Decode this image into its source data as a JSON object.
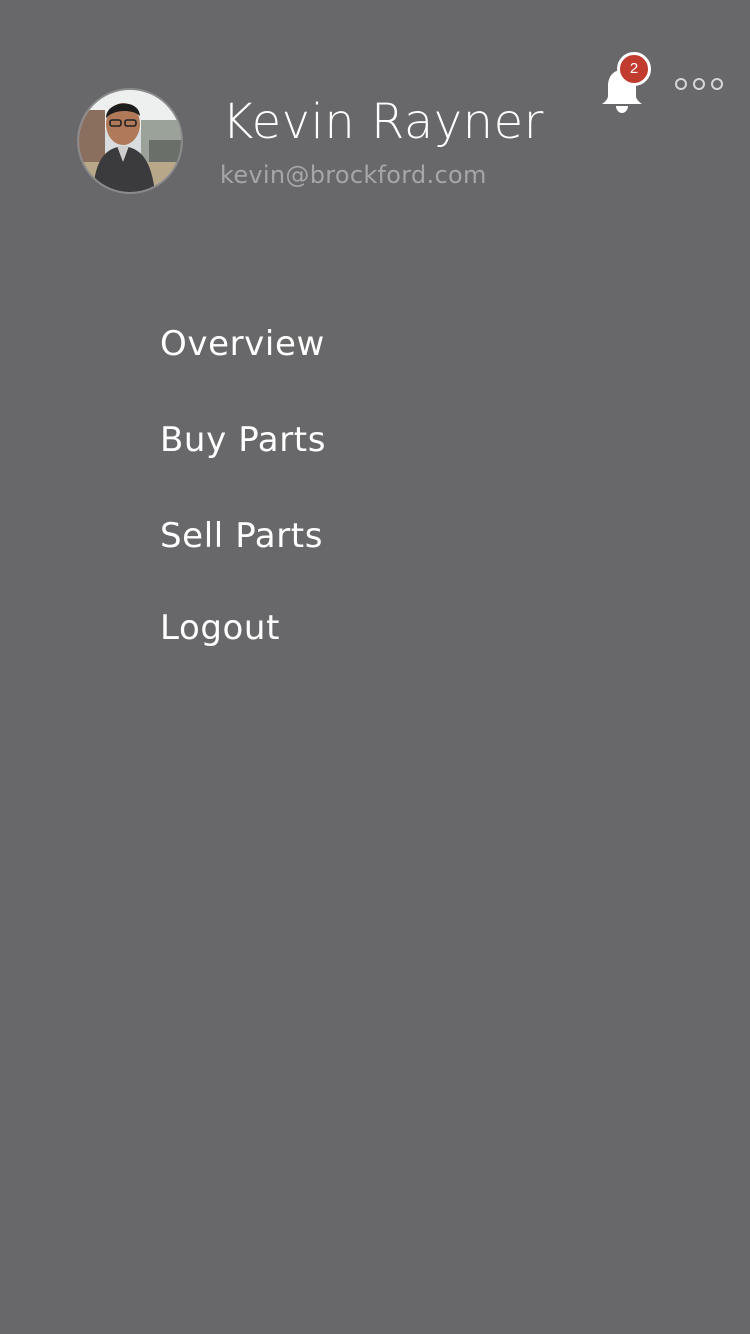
{
  "header": {
    "notifications": {
      "icon": "bell-icon",
      "count": "2",
      "badge_color": "#c23b2f"
    },
    "more_icon": "more-horizontal-icon"
  },
  "profile": {
    "name": "Kevin Rayner",
    "email": "kevin@brockford.com",
    "avatar": "user-avatar-photo"
  },
  "menu": {
    "items": [
      {
        "label": "Overview"
      },
      {
        "label": "Buy Parts"
      },
      {
        "label": "Sell Parts"
      },
      {
        "label": "Logout"
      }
    ]
  },
  "colors": {
    "background": "#68686a",
    "primary_text": "#ffffff",
    "secondary_text": "#a6a6a8"
  }
}
